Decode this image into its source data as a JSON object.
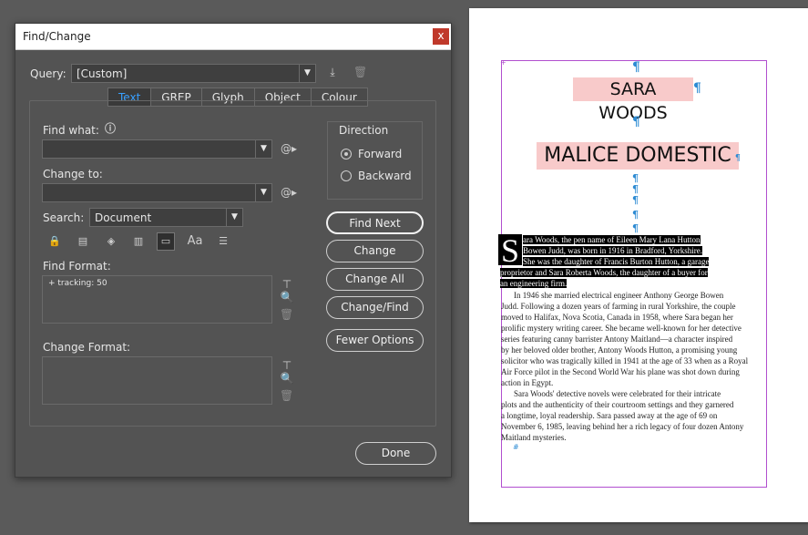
{
  "dialog": {
    "title": "Find/Change",
    "close_symbol": "x",
    "query_label": "Query:",
    "query_value": "[Custom]",
    "tabs": [
      {
        "label": "Text",
        "active": true
      },
      {
        "label": "GREP",
        "active": false
      },
      {
        "label": "Glyph",
        "active": false
      },
      {
        "label": "Object",
        "active": false
      },
      {
        "label": "Colour",
        "active": false
      }
    ],
    "find_what_label": "Find what:",
    "find_what_value": "",
    "change_to_label": "Change to:",
    "change_to_value": "",
    "search_label": "Search:",
    "search_value": "Document",
    "find_format_label": "Find Format:",
    "find_format_value": "+ tracking: 50",
    "change_format_label": "Change Format:",
    "direction_label": "Direction",
    "direction_forward": "Forward",
    "direction_backward": "Backward",
    "direction_selected": "Forward",
    "buttons": {
      "find_next": "Find Next",
      "change": "Change",
      "change_all": "Change All",
      "change_find": "Change/Find",
      "fewer_options": "Fewer Options",
      "done": "Done"
    },
    "colors": {
      "active_tab": "#39a0ff",
      "close": "#c0392b"
    }
  },
  "document": {
    "heading1": "SARA WOODS",
    "heading2": "MALICE DOMESTIC",
    "dropcap": "S",
    "para1_lines": [
      "ara Woods, the pen name of Eileen Mary Lana Hutton",
      "Bowen Judd, was born in 1916 in Bradford, Yorkshire.",
      "She was the daughter of Francis Burton Hutton, a garage",
      "proprietor and Sara Roberta Woods, the daughter of a buyer for",
      "an engineering firm."
    ],
    "para2_lines": [
      "In 1946 she married electrical engineer Anthony George Bowen",
      "Judd. Following a dozen years of farming in rural Yorkshire, the couple",
      "moved to Halifax, Nova Scotia, Canada in 1958, where Sara began her",
      "prolific mystery writing career.  She became well-known for her detective",
      "series featuring canny barrister Antony Maitland—a character inspired",
      "by her beloved older brother, Antony Woods Hutton, a promising young",
      "solicitor who was tragically killed in 1941 at the age of 33 when as a Royal",
      "Air Force pilot in the Second World War his plane was shot down during",
      "action in Egypt."
    ],
    "para3_lines": [
      "Sara Woods' detective novels were celebrated for their intricate",
      "plots and the authenticity of their courtroom settings and they garnered",
      "a longtime, loyal readership. Sara passed away at the age of 69 on",
      "November 6, 1985, leaving behind her a rich legacy of four dozen Antony",
      "Maitland mysteries."
    ],
    "pilcrow": "¶",
    "colors": {
      "heading_bg": "#f8caca",
      "frame": "#b14fcf",
      "hidden_chars": "#2d8bd3"
    }
  }
}
